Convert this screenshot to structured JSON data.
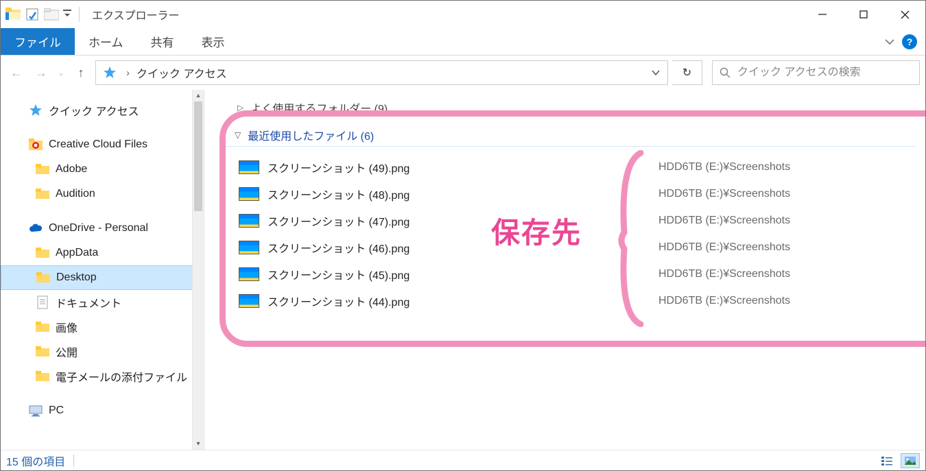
{
  "window": {
    "title": "エクスプローラー"
  },
  "ribbon": {
    "file": "ファイル",
    "tabs": [
      "ホーム",
      "共有",
      "表示"
    ]
  },
  "address": {
    "location": "クイック アクセス"
  },
  "search": {
    "placeholder": "クイック アクセスの検索"
  },
  "sidebar": {
    "items": [
      {
        "name": "quick-access",
        "label": "クイック アクセス",
        "icon": "star",
        "depth": 1
      },
      {
        "name": "creative-cloud",
        "label": "Creative Cloud Files",
        "icon": "cc",
        "depth": 1,
        "gapBefore": true
      },
      {
        "name": "adobe",
        "label": "Adobe",
        "icon": "folder",
        "depth": 2
      },
      {
        "name": "audition",
        "label": "Audition",
        "icon": "folder",
        "depth": 2
      },
      {
        "name": "onedrive",
        "label": "OneDrive - Personal",
        "icon": "cloud",
        "depth": 1,
        "gapBefore": true
      },
      {
        "name": "appdata",
        "label": "AppData",
        "icon": "folder",
        "depth": 2
      },
      {
        "name": "desktop",
        "label": "Desktop",
        "icon": "folder",
        "depth": 2,
        "selected": true
      },
      {
        "name": "documents",
        "label": "ドキュメント",
        "icon": "doc",
        "depth": 2
      },
      {
        "name": "pictures",
        "label": "画像",
        "icon": "folder",
        "depth": 2
      },
      {
        "name": "public",
        "label": "公開",
        "icon": "folder",
        "depth": 2
      },
      {
        "name": "mail-attach",
        "label": "電子メールの添付ファイル",
        "icon": "folder",
        "depth": 2
      },
      {
        "name": "pc",
        "label": "PC",
        "icon": "pc",
        "depth": 1,
        "gapBefore": true
      }
    ]
  },
  "groups": {
    "frequent": {
      "title": "よく使用するフォルダー (9)"
    },
    "recent": {
      "title": "最近使用したファイル (6)"
    }
  },
  "files": [
    {
      "name": "スクリーンショット (49).png",
      "path": "HDD6TB (E:)¥Screenshots"
    },
    {
      "name": "スクリーンショット (48).png",
      "path": "HDD6TB (E:)¥Screenshots"
    },
    {
      "name": "スクリーンショット (47).png",
      "path": "HDD6TB (E:)¥Screenshots"
    },
    {
      "name": "スクリーンショット (46).png",
      "path": "HDD6TB (E:)¥Screenshots"
    },
    {
      "name": "スクリーンショット (45).png",
      "path": "HDD6TB (E:)¥Screenshots"
    },
    {
      "name": "スクリーンショット (44).png",
      "path": "HDD6TB (E:)¥Screenshots"
    }
  ],
  "annotation": {
    "label": "保存先"
  },
  "status": {
    "text": "15 個の項目"
  }
}
